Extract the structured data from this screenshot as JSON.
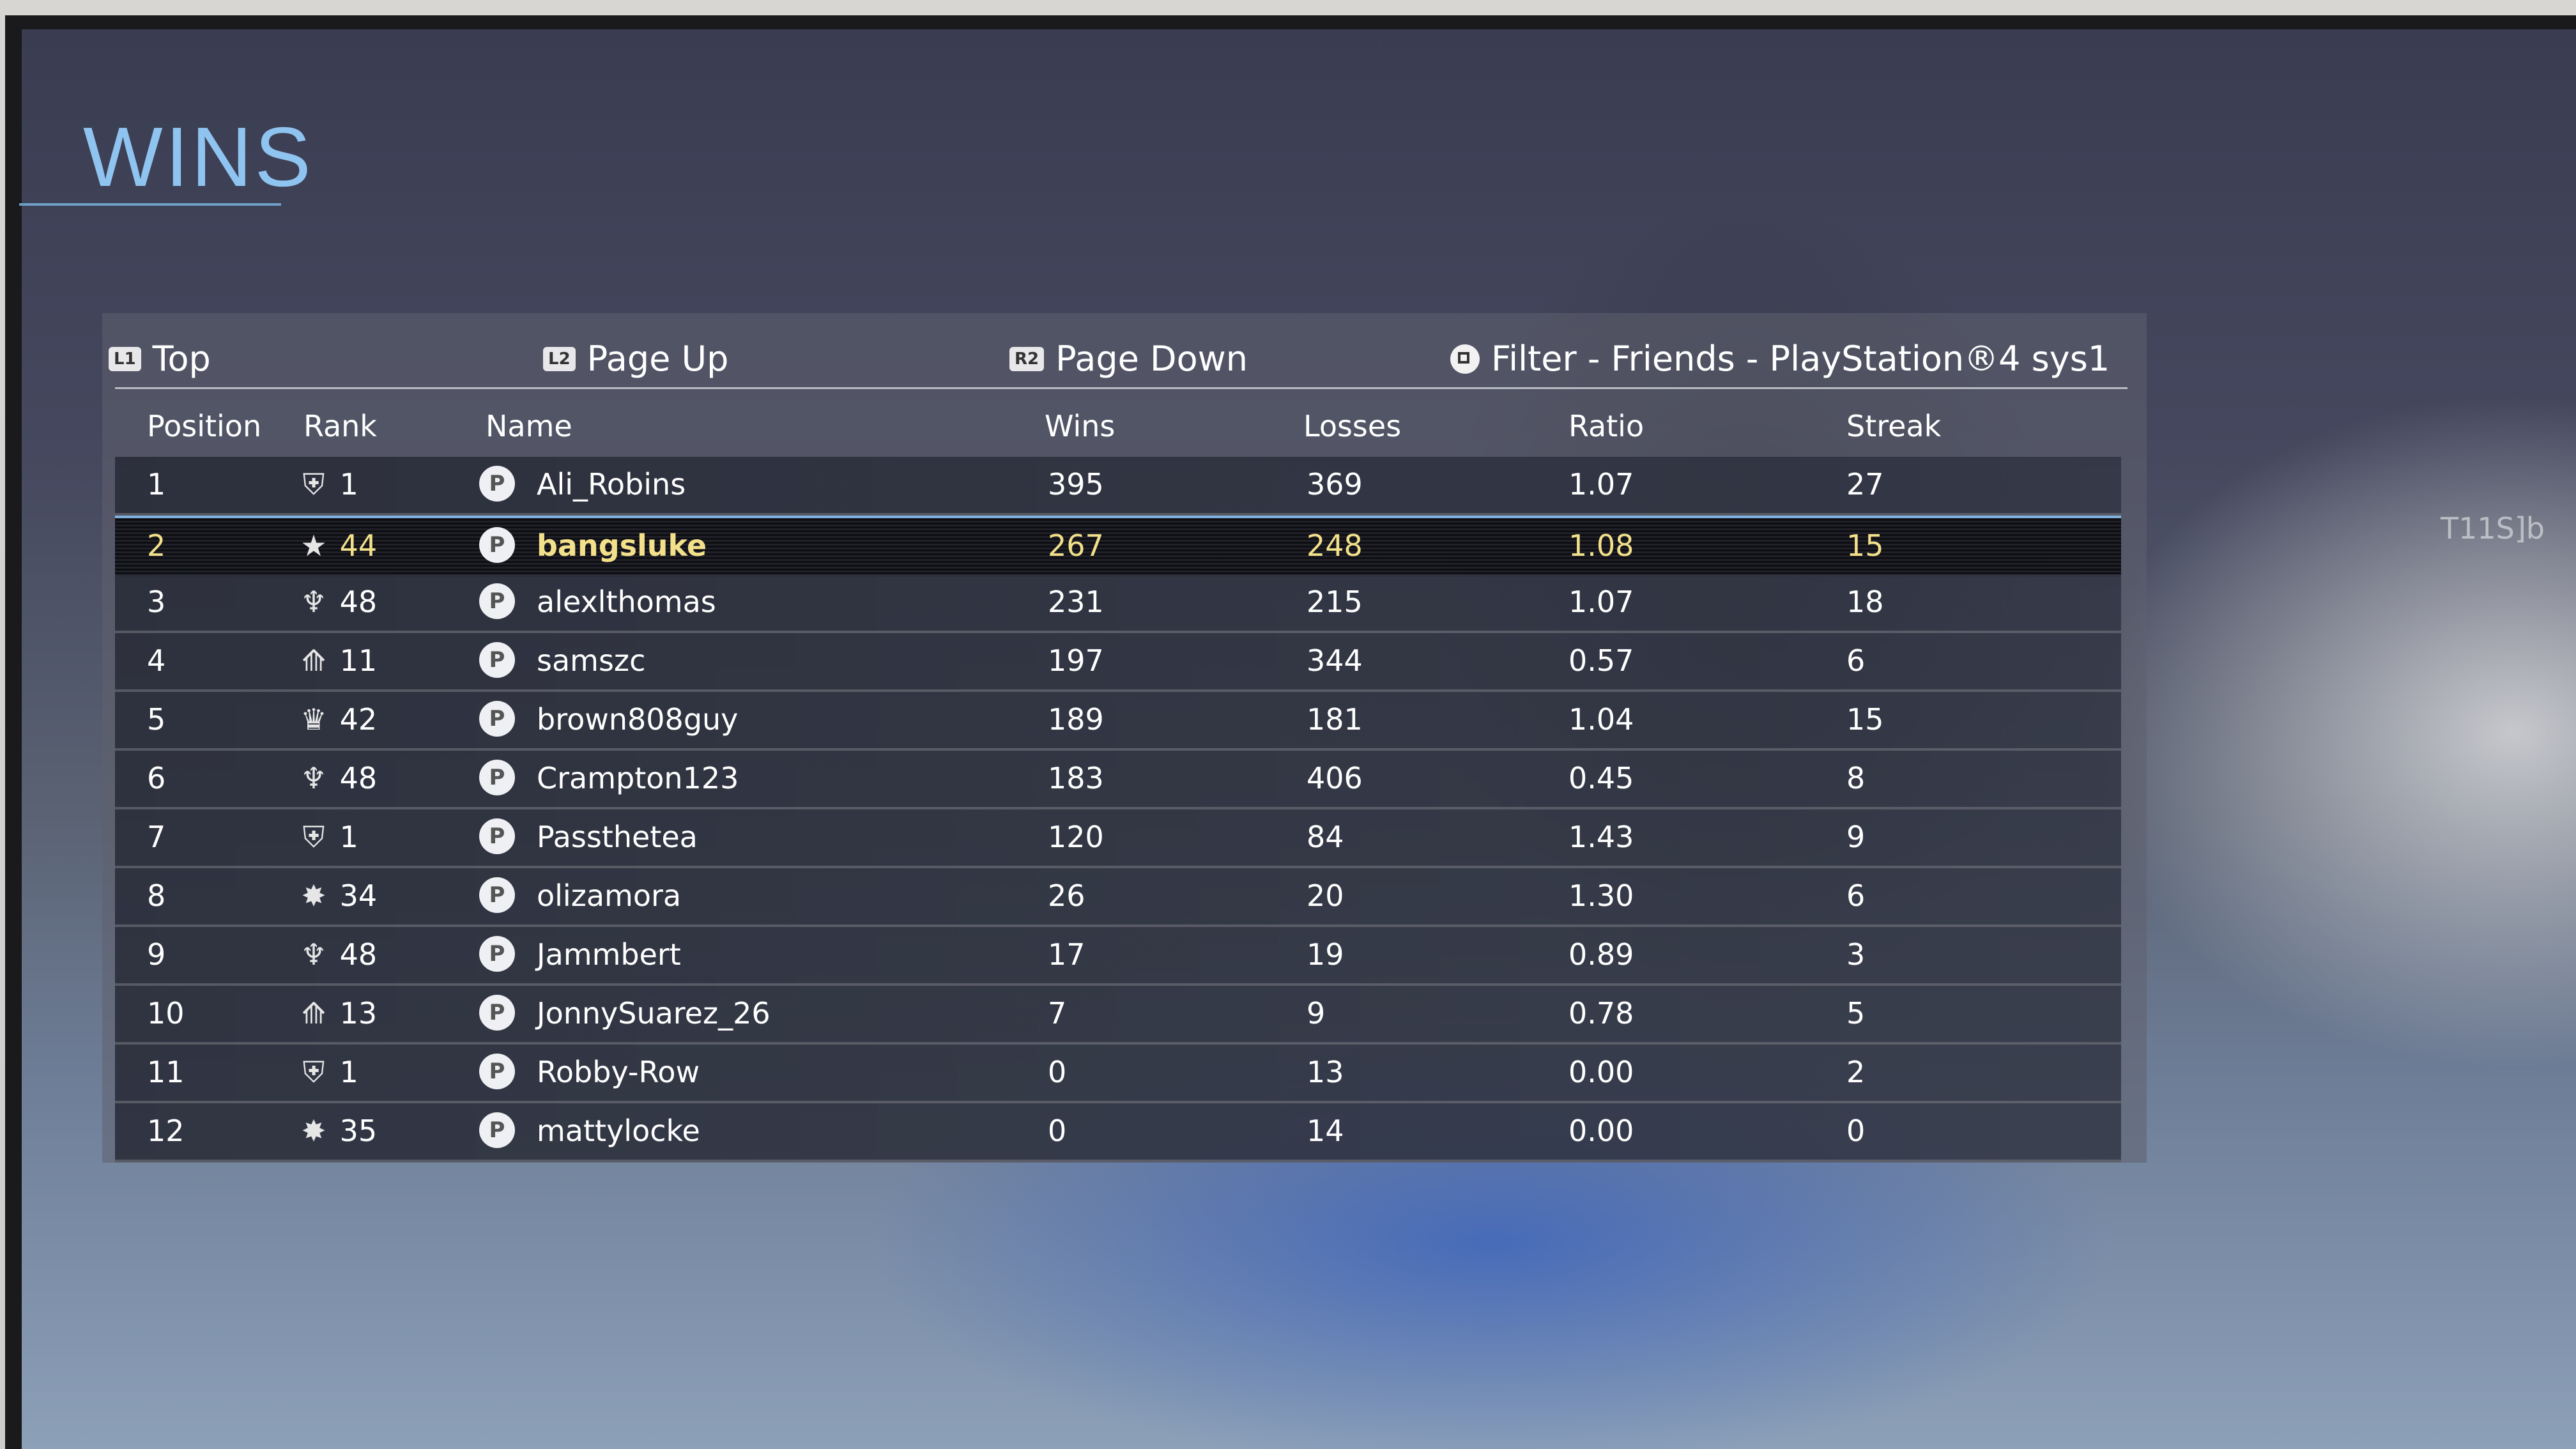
{
  "title": "WINS",
  "toolbar": {
    "top": {
      "glyph": "L1",
      "label": "Top"
    },
    "page_up": {
      "glyph": "L2",
      "label": "Page Up"
    },
    "page_down": {
      "glyph": "R2",
      "label": "Page Down"
    },
    "filter": {
      "label": "Filter - Friends - PlayStation®4 sys1"
    }
  },
  "columns": {
    "position": "Position",
    "rank": "Rank",
    "name": "Name",
    "wins": "Wins",
    "losses": "Losses",
    "ratio": "Ratio",
    "streak": "Streak"
  },
  "rows": [
    {
      "position": "1",
      "rank_icon": "⛨",
      "rank": "1",
      "name": "Ali_Robins",
      "wins": "395",
      "losses": "369",
      "ratio": "1.07",
      "streak": "27"
    },
    {
      "position": "2",
      "rank_icon": "★",
      "rank": "44",
      "name": "bangsluke",
      "wins": "267",
      "losses": "248",
      "ratio": "1.08",
      "streak": "15"
    },
    {
      "position": "3",
      "rank_icon": "♆",
      "rank": "48",
      "name": "alexlthomas",
      "wins": "231",
      "losses": "215",
      "ratio": "1.07",
      "streak": "18"
    },
    {
      "position": "4",
      "rank_icon": "⟰",
      "rank": "11",
      "name": "samszc",
      "wins": "197",
      "losses": "344",
      "ratio": "0.57",
      "streak": "6"
    },
    {
      "position": "5",
      "rank_icon": "♛",
      "rank": "42",
      "name": "brown808guy",
      "wins": "189",
      "losses": "181",
      "ratio": "1.04",
      "streak": "15"
    },
    {
      "position": "6",
      "rank_icon": "♆",
      "rank": "48",
      "name": "Crampton123",
      "wins": "183",
      "losses": "406",
      "ratio": "0.45",
      "streak": "8"
    },
    {
      "position": "7",
      "rank_icon": "⛨",
      "rank": "1",
      "name": "Passthetea",
      "wins": "120",
      "losses": "84",
      "ratio": "1.43",
      "streak": "9"
    },
    {
      "position": "8",
      "rank_icon": "✸",
      "rank": "34",
      "name": "olizamora",
      "wins": "26",
      "losses": "20",
      "ratio": "1.30",
      "streak": "6"
    },
    {
      "position": "9",
      "rank_icon": "♆",
      "rank": "48",
      "name": "Jammbert",
      "wins": "17",
      "losses": "19",
      "ratio": "0.89",
      "streak": "3"
    },
    {
      "position": "10",
      "rank_icon": "⟰",
      "rank": "13",
      "name": "JonnySuarez_26",
      "wins": "7",
      "losses": "9",
      "ratio": "0.78",
      "streak": "5"
    },
    {
      "position": "11",
      "rank_icon": "⛨",
      "rank": "1",
      "name": "Robby-Row",
      "wins": "0",
      "losses": "13",
      "ratio": "0.00",
      "streak": "2"
    },
    {
      "position": "12",
      "rank_icon": "✸",
      "rank": "35",
      "name": "mattylocke",
      "wins": "0",
      "losses": "14",
      "ratio": "0.00",
      "streak": "0"
    }
  ],
  "selected_row": 1,
  "reflection_text": "T11S]b",
  "colors": {
    "title": "#8fc4f0",
    "selected_text": "#f2e08a",
    "selection_line": "#7fb2e0"
  },
  "icons": {
    "player": "playstation-icon",
    "filter": "square-button-icon"
  }
}
